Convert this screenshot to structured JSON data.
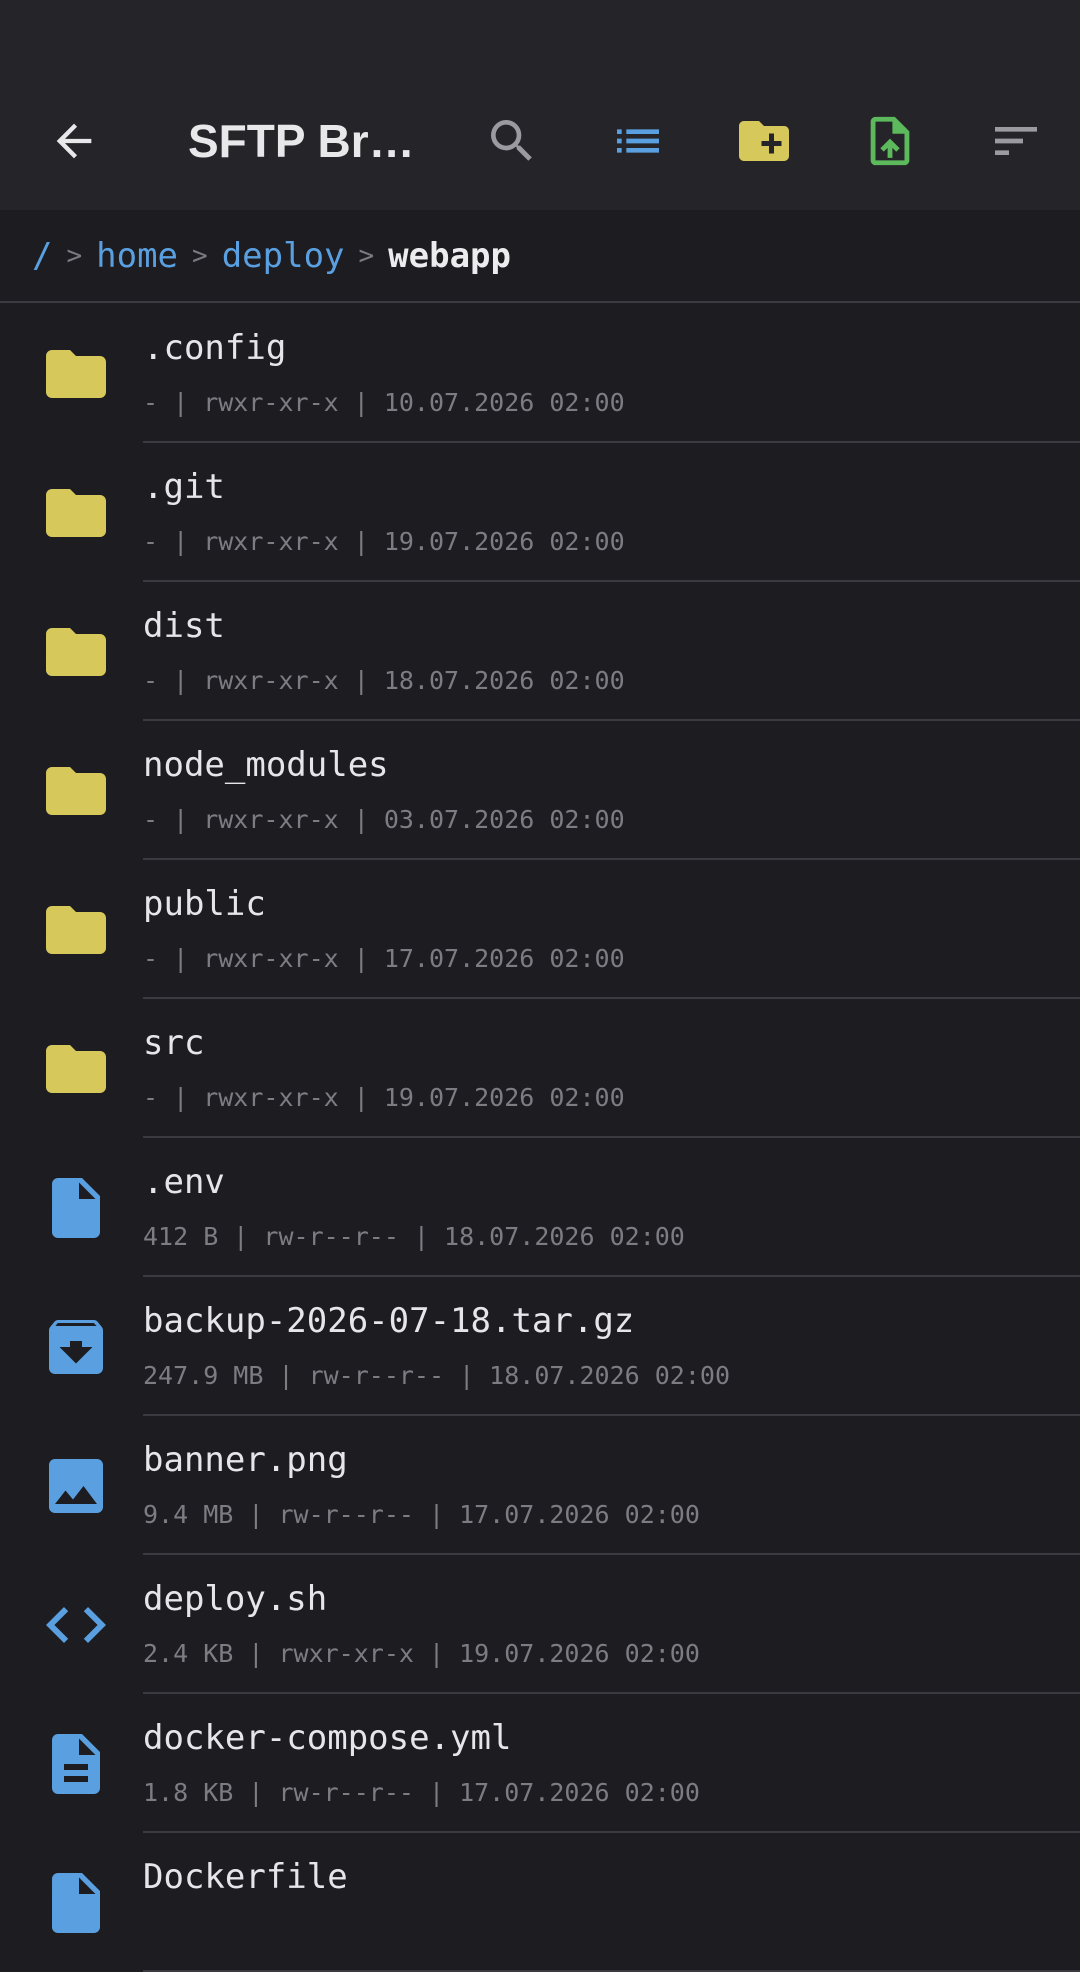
{
  "toolbar": {
    "title": "SFTP Br…",
    "back_icon": "arrow-back-icon",
    "search_icon": "search-icon",
    "list_view_icon": "list-view-icon",
    "new_folder_icon": "create-folder-icon",
    "upload_icon": "upload-file-icon",
    "sort_icon": "sort-icon",
    "colors": {
      "list": "#5aa0e0",
      "folder": "#d6c85a",
      "upload": "#5cba5c",
      "neutral": "#b0b0b5"
    }
  },
  "breadcrumb": {
    "root": "/",
    "separator": ">",
    "parts": [
      "home",
      "deploy"
    ],
    "current": "webapp"
  },
  "files": [
    {
      "name": ".config",
      "meta": "- | rwxr-xr-x | 10.07.2026 02:00",
      "icon": "folder-icon"
    },
    {
      "name": ".git",
      "meta": "- | rwxr-xr-x | 19.07.2026 02:00",
      "icon": "folder-icon"
    },
    {
      "name": "dist",
      "meta": "- | rwxr-xr-x | 18.07.2026 02:00",
      "icon": "folder-icon"
    },
    {
      "name": "node_modules",
      "meta": "- | rwxr-xr-x | 03.07.2026 02:00",
      "icon": "folder-icon"
    },
    {
      "name": "public",
      "meta": "- | rwxr-xr-x | 17.07.2026 02:00",
      "icon": "folder-icon"
    },
    {
      "name": "src",
      "meta": "- | rwxr-xr-x | 19.07.2026 02:00",
      "icon": "folder-icon"
    },
    {
      "name": ".env",
      "meta": "412 B | rw-r--r-- | 18.07.2026 02:00",
      "icon": "file-icon"
    },
    {
      "name": "backup-2026-07-18.tar.gz",
      "meta": "247.9 MB | rw-r--r-- | 18.07.2026 02:00",
      "icon": "archive-icon"
    },
    {
      "name": "banner.png",
      "meta": "9.4 MB | rw-r--r-- | 17.07.2026 02:00",
      "icon": "image-icon"
    },
    {
      "name": "deploy.sh",
      "meta": "2.4 KB | rwxr-xr-x | 19.07.2026 02:00",
      "icon": "code-icon"
    },
    {
      "name": "docker-compose.yml",
      "meta": "1.8 KB | rw-r--r-- | 17.07.2026 02:00",
      "icon": "text-file-icon"
    },
    {
      "name": "Dockerfile",
      "meta": "",
      "icon": "file-icon"
    }
  ],
  "colors": {
    "folder": "#d6c85a",
    "file": "#5aa0e0"
  }
}
